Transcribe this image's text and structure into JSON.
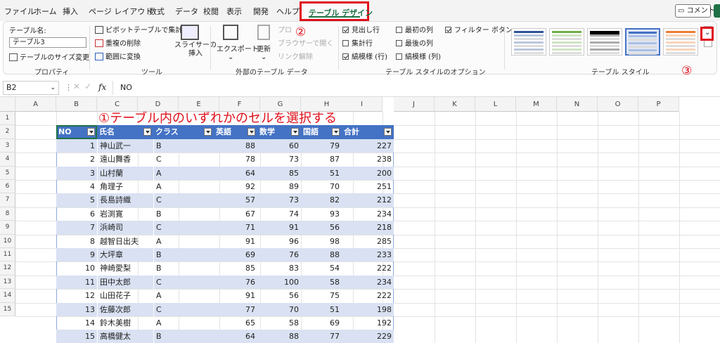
{
  "menu": {
    "tabs": [
      "ファイル",
      "ホーム",
      "挿入",
      "ページ レイアウト",
      "数式",
      "データ",
      "校閲",
      "表示",
      "開発",
      "ヘルプ"
    ],
    "active_tab": "テーブル デザイン",
    "comment_label": "コメント"
  },
  "ribbon": {
    "name_label": "テーブル名:",
    "name_value": "テーブル3",
    "resize_label": "テーブルのサイズ変更",
    "group_properties": "プロパティ",
    "pivot_label": "ピボットテーブルで集計",
    "remove_dup_label": "重複の削除",
    "convert_label": "範囲に変換",
    "slicer_label": "スライサーの",
    "slicer_label2": "挿入",
    "group_tools": "ツール",
    "export_label": "エクスポート",
    "refresh_label": "更新",
    "prop_label": "プロ",
    "browser_label": "ブラウザーで開く",
    "unlink_label": "リンク解除",
    "group_external": "外部のテーブル データ",
    "opt_header": "見出し行",
    "opt_total": "集計行",
    "opt_banded_rows": "縞模様 (行)",
    "opt_first_col": "最初の列",
    "opt_last_col": "最後の列",
    "opt_banded_cols": "縞模様 (列)",
    "opt_filter": "フィルター ボタン",
    "group_options": "テーブル スタイルのオプション",
    "group_styles": "テーブル スタイル",
    "checks": {
      "header": true,
      "total": false,
      "banded_rows": true,
      "first_col": false,
      "last_col": false,
      "banded_cols": false,
      "filter": true
    },
    "swatch_colors": [
      "#2f5597",
      "#70ad47",
      "#000000",
      "#4472c4",
      "#ed7d31"
    ]
  },
  "annotations": {
    "step1": "①テーブル内のいずれかのセルを選択する",
    "step2": "②",
    "step3": "③"
  },
  "formula_bar": {
    "name_box": "B2",
    "fx": "fx",
    "content": "NO"
  },
  "columns": [
    "A",
    "B",
    "C",
    "D",
    "E",
    "F",
    "G",
    "H",
    "I",
    "J",
    "K",
    "L",
    "M",
    "N",
    "O",
    "P"
  ],
  "rows": [
    "1",
    "2",
    "3",
    "4",
    "5",
    "6",
    "7",
    "8",
    "9",
    "10",
    "11",
    "12",
    "13",
    "14",
    "15"
  ],
  "table": {
    "headers": [
      "NO",
      "氏名",
      "クラス",
      "英語",
      "数学",
      "国語",
      "合計"
    ],
    "rows": [
      [
        "1",
        "神山武一",
        "B",
        "88",
        "60",
        "79",
        "227"
      ],
      [
        "2",
        "遠山舞香",
        "C",
        "78",
        "73",
        "87",
        "238"
      ],
      [
        "3",
        "山村蘭",
        "A",
        "64",
        "85",
        "51",
        "200"
      ],
      [
        "4",
        "角理子",
        "A",
        "92",
        "89",
        "70",
        "251"
      ],
      [
        "5",
        "長島詩織",
        "C",
        "57",
        "73",
        "82",
        "212"
      ],
      [
        "6",
        "岩渕寛",
        "B",
        "67",
        "74",
        "93",
        "234"
      ],
      [
        "7",
        "浜崎司",
        "C",
        "71",
        "91",
        "56",
        "218"
      ],
      [
        "8",
        "越智日出夫",
        "A",
        "91",
        "96",
        "98",
        "285"
      ],
      [
        "9",
        "大坪章",
        "B",
        "69",
        "76",
        "88",
        "233"
      ],
      [
        "10",
        "神崎愛梨",
        "B",
        "85",
        "83",
        "54",
        "222"
      ],
      [
        "11",
        "田中太郎",
        "C",
        "76",
        "100",
        "58",
        "234"
      ],
      [
        "12",
        "山田花子",
        "A",
        "91",
        "56",
        "75",
        "222"
      ],
      [
        "13",
        "佐藤次郎",
        "C",
        "77",
        "70",
        "51",
        "198"
      ],
      [
        "14",
        "鈴木美樹",
        "A",
        "65",
        "58",
        "69",
        "192"
      ],
      [
        "15",
        "高橋健太",
        "B",
        "64",
        "88",
        "77",
        "229"
      ]
    ]
  }
}
